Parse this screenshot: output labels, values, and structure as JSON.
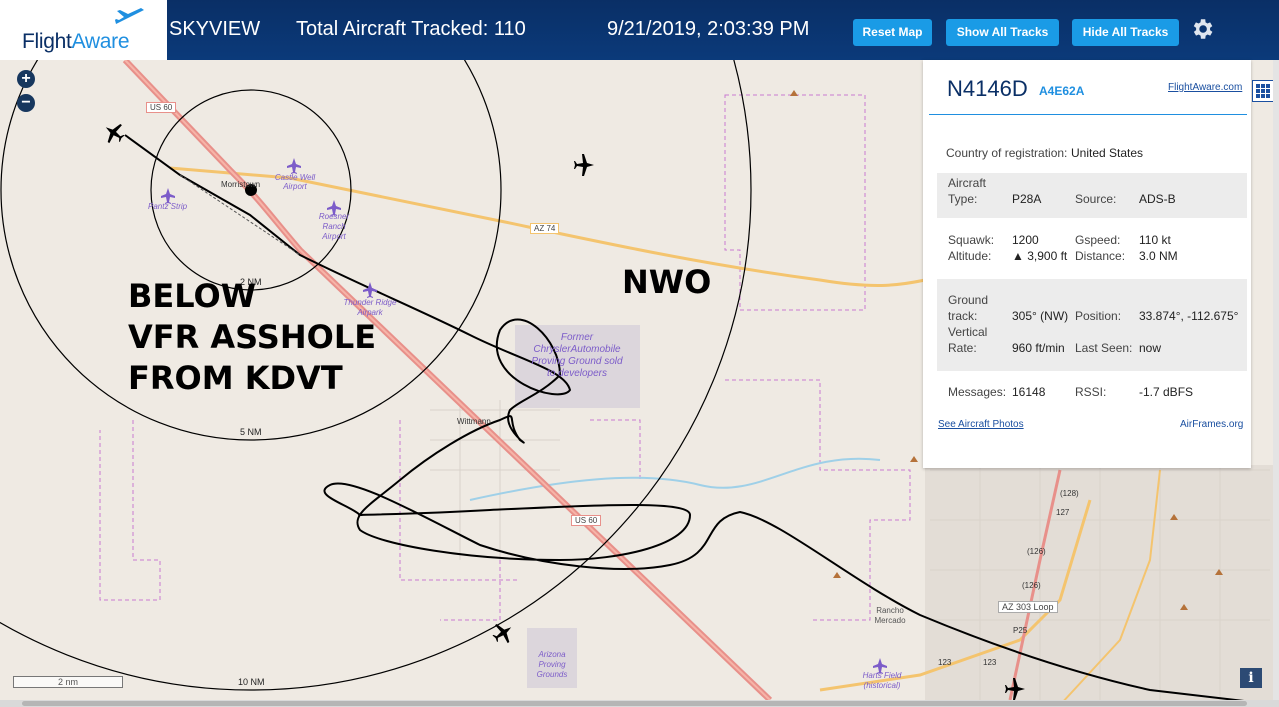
{
  "header": {
    "logo_a": "Flight",
    "logo_b": "Aware",
    "app_name": "SKYVIEW",
    "tracked_label": "Total Aircraft Tracked: 110",
    "datetime": "9/21/2019, 2:03:39 PM",
    "buttons": [
      "Reset Map",
      "Show All Tracks",
      "Hide All Tracks"
    ]
  },
  "map_labels": {
    "roads": [
      "US 60",
      "AZ 74",
      "US 60",
      "AZ 303 Loop",
      "123",
      "123",
      "(128)",
      "127",
      "(126)",
      "(126)",
      "P25"
    ],
    "places": [
      "Morristown",
      "Wittmann",
      "Rancho Mercado"
    ],
    "airports": [
      "Castle Well Airport",
      "Roesner Ranch Airport",
      "Pantz Strip",
      "Thunder Ridge Airpark",
      "Harts Field (historical)"
    ],
    "areas": [
      "Former ChryslerAutomobile Proving Ground sold to developers",
      "Arizona Proving Grounds"
    ],
    "rings": [
      "2 NM",
      "5 NM",
      "10 NM"
    ],
    "scale": "2 nm"
  },
  "overlay": {
    "lines": [
      "BELOW",
      "VFR ASSHOLE",
      "FROM KDVT"
    ],
    "nwo": "NWO"
  },
  "panel": {
    "tail": "N4146D",
    "hex": "A4E62A",
    "link_fa": "FlightAware.com",
    "country_label": "Country of registration:",
    "country_value": "United States",
    "aircraft_label_1": "Aircraft",
    "aircraft_label_2": "Type:",
    "aircraft_value": "P28A",
    "source_label": "Source:",
    "source_value": "ADS-B",
    "squawk_label": "Squawk:",
    "squawk_value": "1200",
    "gspeed_label": "Gspeed:",
    "gspeed_value": "110 kt",
    "altitude_label": "Altitude:",
    "altitude_value": "▲ 3,900 ft",
    "distance_label": "Distance:",
    "distance_value": "3.0 NM",
    "track_label_1": "Ground",
    "track_label_2": "track:",
    "track_value": "305° (NW)",
    "position_label": "Position:",
    "position_value": "33.874°, -112.675°",
    "vrate_label_1": "Vertical",
    "vrate_label_2": "Rate:",
    "vrate_value": "960 ft/min",
    "lastseen_label": "Last Seen:",
    "lastseen_value": "now",
    "messages_label": "Messages:",
    "messages_value": "16148",
    "rssi_label": "RSSI:",
    "rssi_value": "-1.7 dBFS",
    "link_photos": "See Aircraft Photos",
    "link_airframes": "AirFrames.org"
  },
  "colors": {
    "header_bg": "#0b3a7a",
    "button_bg": "#1a9be6",
    "map_bg": "#efeae3",
    "highway": "#e8908a",
    "state_road": "#f4c46e",
    "boundary": "#c87ad0",
    "water": "#9fd0e8",
    "track": "#000000"
  },
  "icons": [
    "plane-logo-icon",
    "gear-icon",
    "zoom-in-icon",
    "zoom-out-icon",
    "grid-icon",
    "info-icon",
    "aircraft-icon",
    "airport-icon"
  ]
}
